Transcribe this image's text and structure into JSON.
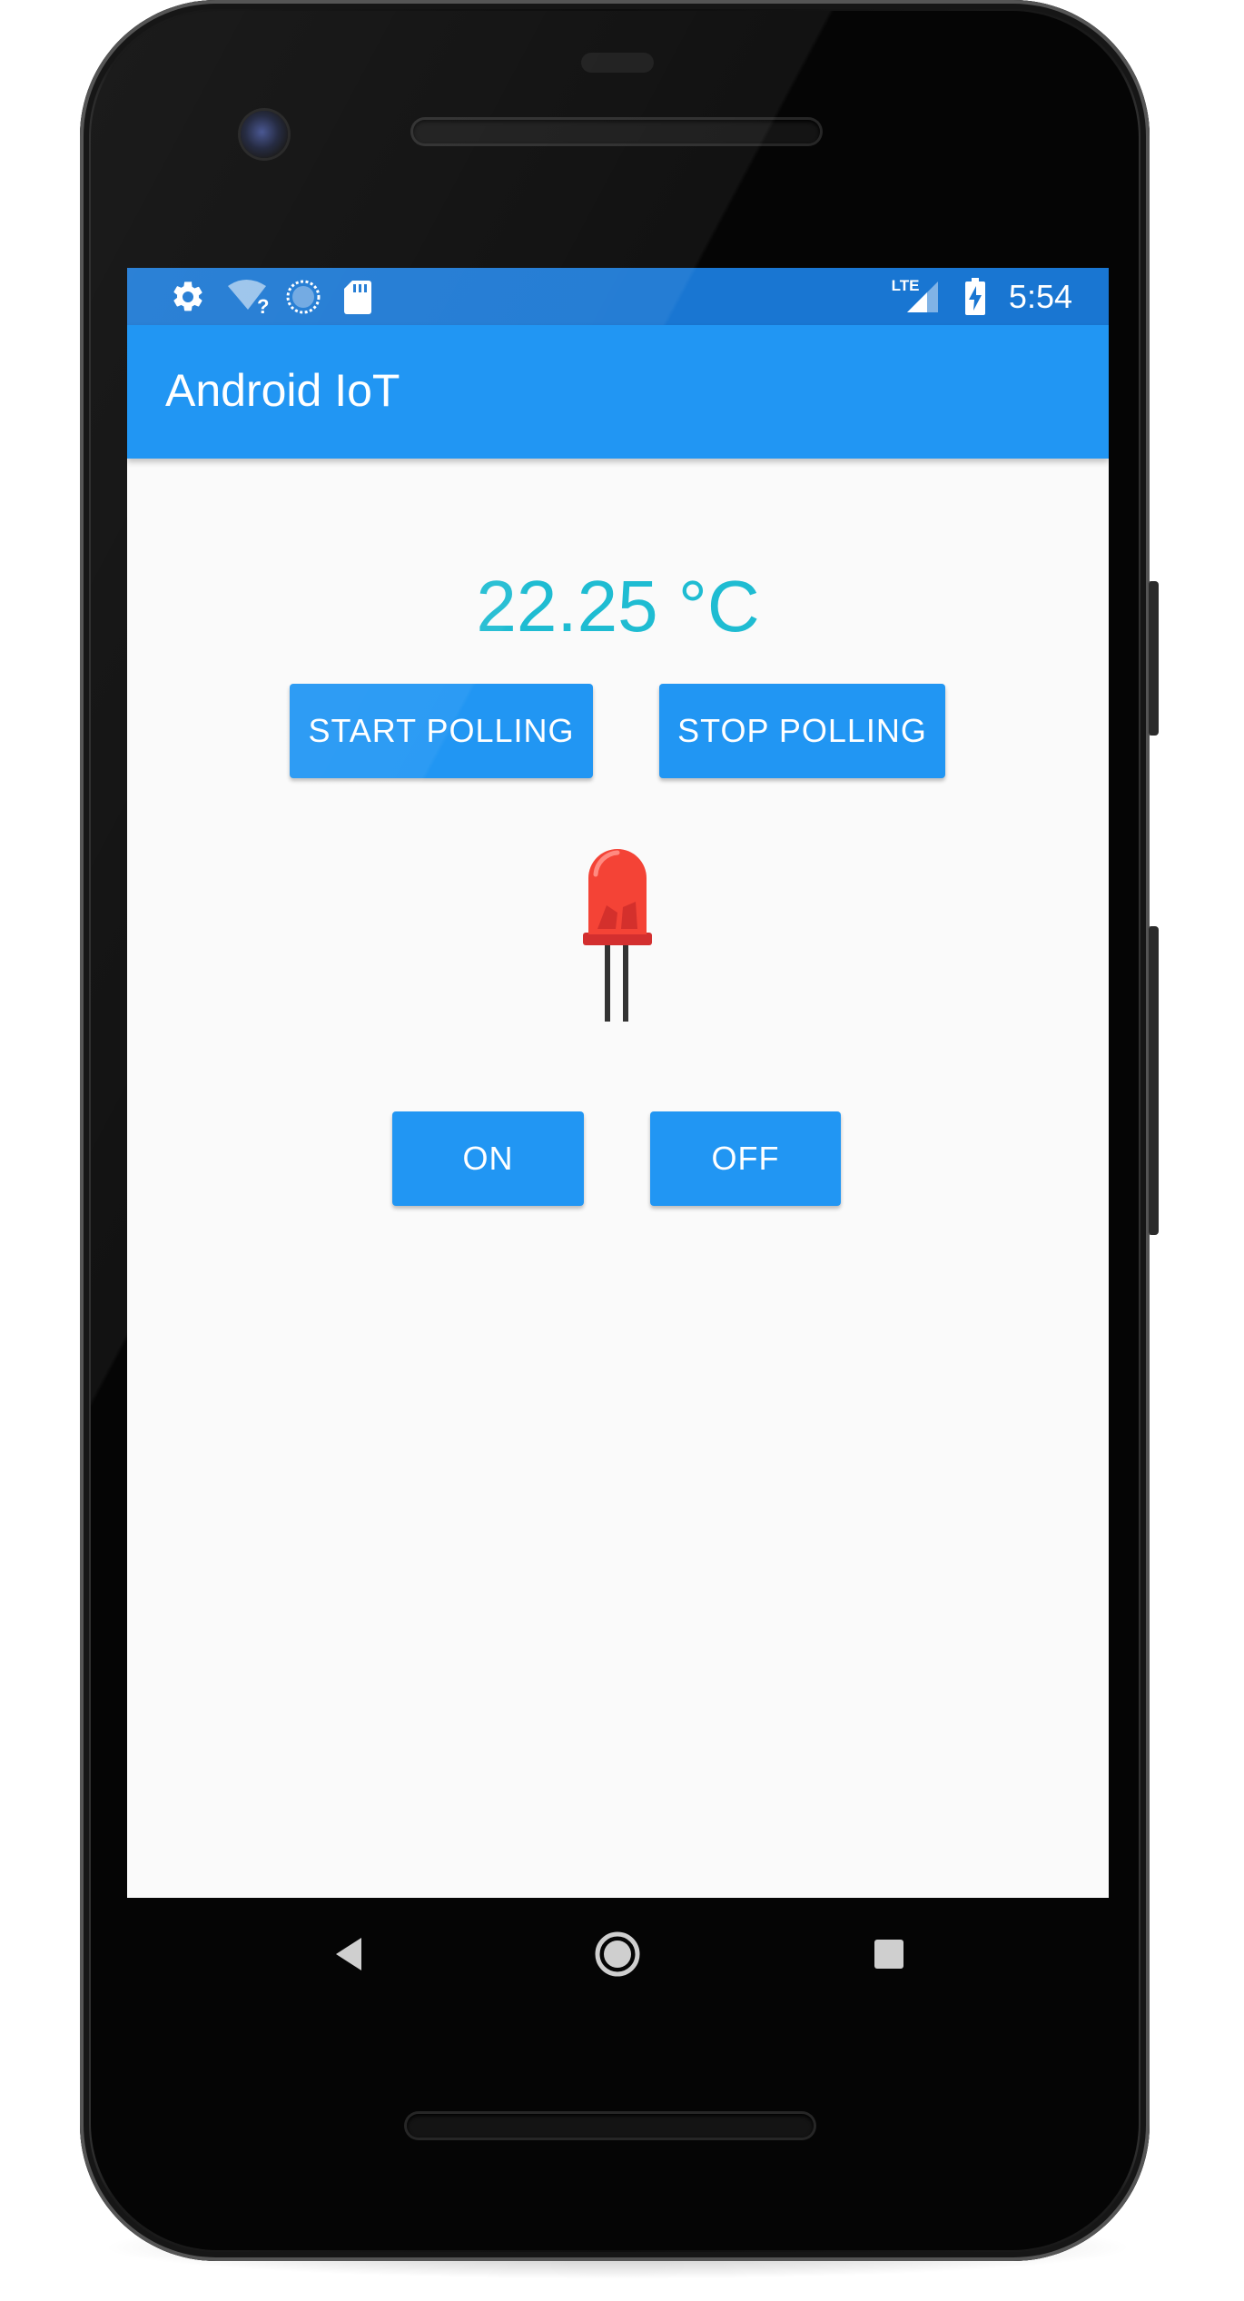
{
  "status_bar": {
    "time": "5:54",
    "network_label": "LTE",
    "icons": [
      "gear-icon",
      "wifi-unknown-icon",
      "sync-icon",
      "sd-card-icon",
      "lte-icon",
      "signal-icon",
      "battery-charging-icon"
    ]
  },
  "app_bar": {
    "title": "Android IoT"
  },
  "main": {
    "temperature": "22.25 °C",
    "start_polling_label": "START POLLING",
    "stop_polling_label": "STOP POLLING",
    "led_icon": "red-led-icon",
    "led_color": "#e53935",
    "on_label": "ON",
    "off_label": "OFF"
  },
  "nav_bar": {
    "icons": [
      "back-icon",
      "home-icon",
      "recents-icon"
    ]
  },
  "colors": {
    "status_bar": "#1976d2",
    "app_bar": "#2196f3",
    "button": "#2196f3",
    "temperature_text": "#1fbcd2",
    "background": "#fafafa"
  }
}
